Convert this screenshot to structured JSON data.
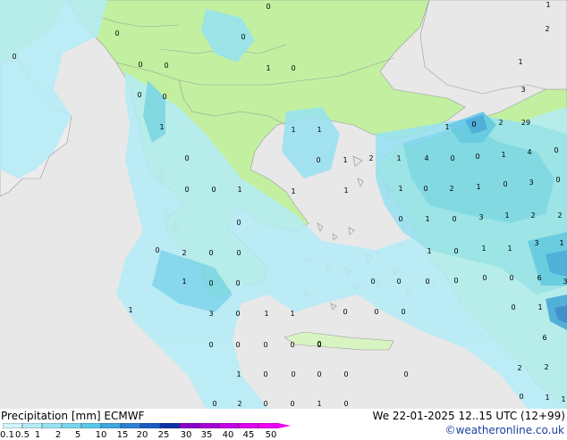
{
  "title": "Precipitation [mm]  ECMWF",
  "valid_time": "We 22-01-2025 12..15 UTC (12+99)",
  "credit": "©weatheronline.co.uk",
  "colors": {
    "land": "#c2f0a0",
    "sea": "#e8e8e8",
    "outside": "#ececec",
    "border": "#9a9a9a"
  },
  "legend": {
    "labels": [
      "0.1",
      "0.5",
      "1",
      "2",
      "5",
      "10",
      "15",
      "20",
      "25",
      "30",
      "35",
      "40",
      "45",
      "50"
    ],
    "colors": [
      "#d2f4fa",
      "#b4ecf7",
      "#96e2f2",
      "#78d6ee",
      "#5ac8ea",
      "#3ea6e2",
      "#2a80d4",
      "#1a5ac4",
      "#0c30a8",
      "#8a00c8",
      "#a800d8",
      "#c400e4",
      "#dc00ec",
      "#f000f4"
    ]
  },
  "map_values": [
    {
      "v": "0"
    },
    {
      "v": "0"
    },
    {
      "v": "0"
    },
    {
      "v": "0"
    },
    {
      "v": "0"
    },
    {
      "v": "0"
    },
    {
      "v": "1"
    },
    {
      "v": "0"
    },
    {
      "v": "0"
    },
    {
      "v": "0"
    },
    {
      "v": "1"
    },
    {
      "v": "1"
    },
    {
      "v": "1"
    },
    {
      "v": "0"
    },
    {
      "v": "0"
    },
    {
      "v": "1"
    },
    {
      "v": "2"
    },
    {
      "v": "1"
    },
    {
      "v": "0"
    },
    {
      "v": "0"
    },
    {
      "v": "1"
    },
    {
      "v": "1"
    },
    {
      "v": "1"
    },
    {
      "v": "0"
    },
    {
      "v": "0"
    },
    {
      "v": "2"
    },
    {
      "v": "0"
    },
    {
      "v": "0"
    },
    {
      "v": "1"
    },
    {
      "v": "0"
    },
    {
      "v": "0"
    },
    {
      "v": "1"
    },
    {
      "v": "3"
    },
    {
      "v": "0"
    },
    {
      "v": "1"
    },
    {
      "v": "1"
    },
    {
      "v": "0"
    },
    {
      "v": "0"
    },
    {
      "v": "0"
    },
    {
      "v": "0"
    },
    {
      "v": "0"
    },
    {
      "v": "0"
    },
    {
      "v": "0"
    },
    {
      "v": "0"
    },
    {
      "v": "0"
    },
    {
      "v": "1"
    },
    {
      "v": "0"
    },
    {
      "v": "0"
    },
    {
      "v": "0"
    },
    {
      "v": "0"
    },
    {
      "v": "0"
    },
    {
      "v": "0"
    },
    {
      "v": "0"
    },
    {
      "v": "0"
    },
    {
      "v": "0"
    },
    {
      "v": "0"
    },
    {
      "v": "0"
    },
    {
      "v": "1"
    },
    {
      "v": "0"
    },
    {
      "v": "1"
    },
    {
      "v": "1"
    },
    {
      "v": "0"
    },
    {
      "v": "1"
    },
    {
      "v": "0"
    },
    {
      "v": "3"
    },
    {
      "v": "1"
    },
    {
      "v": "2"
    },
    {
      "v": "2"
    },
    {
      "v": "1"
    },
    {
      "v": "0"
    },
    {
      "v": "2"
    },
    {
      "v": "1"
    },
    {
      "v": "0"
    },
    {
      "v": "3"
    },
    {
      "v": "0"
    },
    {
      "v": "4"
    },
    {
      "v": "0"
    },
    {
      "v": "0"
    },
    {
      "v": "1"
    },
    {
      "v": "4"
    },
    {
      "v": "0"
    },
    {
      "v": "1"
    },
    {
      "v": "0"
    },
    {
      "v": "2"
    },
    {
      "v": "29"
    },
    {
      "v": "2"
    },
    {
      "v": "1"
    },
    {
      "v": "3"
    },
    {
      "v": "1"
    },
    {
      "v": "3"
    },
    {
      "v": "1"
    },
    {
      "v": "6"
    },
    {
      "v": "3"
    },
    {
      "v": "0"
    },
    {
      "v": "1"
    },
    {
      "v": "6"
    },
    {
      "v": "2"
    },
    {
      "v": "2"
    },
    {
      "v": "0"
    },
    {
      "v": "1"
    },
    {
      "v": "1"
    },
    {
      "v": "0"
    },
    {
      "v": "2"
    },
    {
      "v": "0"
    },
    {
      "v": "0"
    },
    {
      "v": "1"
    },
    {
      "v": "0"
    },
    {
      "v": "0"
    }
  ]
}
